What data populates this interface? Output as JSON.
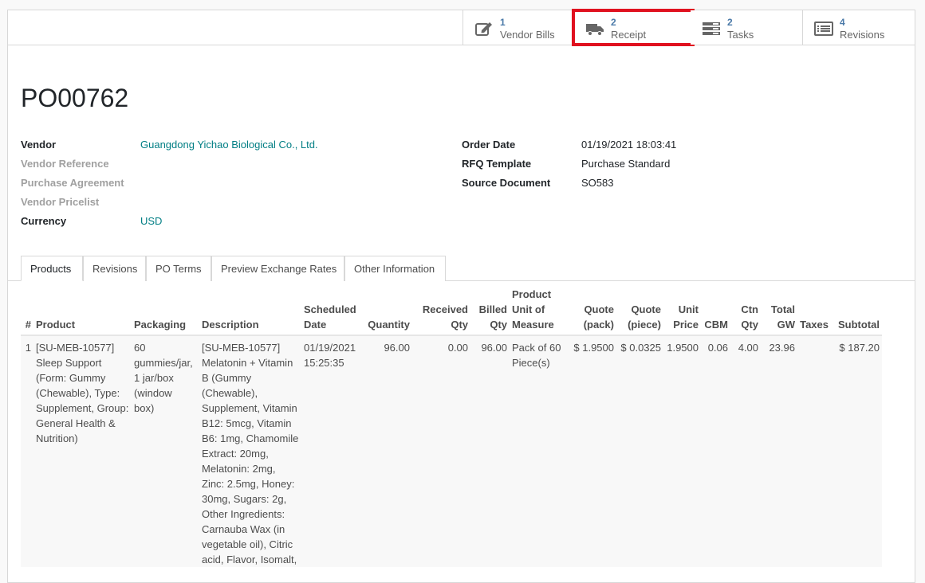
{
  "smart_buttons": [
    {
      "count": "1",
      "label": "Vendor Bills",
      "icon": "pencil-square-icon"
    },
    {
      "count": "2",
      "label": "Receipt",
      "icon": "truck-icon"
    },
    {
      "count": "2",
      "label": "Tasks",
      "icon": "tasks-icon"
    },
    {
      "count": "4",
      "label": "Revisions",
      "icon": "list-alt-icon"
    }
  ],
  "highlight_color": "#e0111f",
  "link_color": "#017e84",
  "po_name": "PO00762",
  "left_fields": [
    {
      "label": "Vendor",
      "value": "Guangdong Yichao Biological Co., Ltd."
    },
    {
      "label": "Vendor Reference",
      "value": ""
    },
    {
      "label": "Purchase Agreement",
      "value": ""
    },
    {
      "label": "Vendor Pricelist",
      "value": ""
    },
    {
      "label": "Currency",
      "value": "USD"
    }
  ],
  "right_fields": [
    {
      "label": "Order Date",
      "value": "01/19/2021 18:03:41"
    },
    {
      "label": "RFQ Template",
      "value": "Purchase Standard"
    },
    {
      "label": "Source Document",
      "value": "SO583"
    }
  ],
  "tabs": [
    "Products",
    "Revisions",
    "PO Terms",
    "Preview Exchange Rates",
    "Other Information"
  ],
  "columns": {
    "num": "#",
    "product": "Product",
    "packaging": "Packaging",
    "description": "Description",
    "scheduled_1": "Scheduled",
    "scheduled_2": "Date",
    "quantity": "Quantity",
    "received_1": "Received",
    "received_2": "Qty",
    "billed_1": "Billed",
    "billed_2": "Qty",
    "uom_1": "Product",
    "uom_2": "Unit of",
    "uom_3": "Measure",
    "quote_pack_1": "Quote",
    "quote_pack_2": "(pack)",
    "quote_piece_1": "Quote",
    "quote_piece_2": "(piece)",
    "unit_price_1": "Unit",
    "unit_price_2": "Price",
    "cbm": "CBM",
    "ctn_1": "Ctn",
    "ctn_2": "Qty",
    "gw_1": "Total",
    "gw_2": "GW",
    "taxes": "Taxes",
    "subtotal": "Subtotal"
  },
  "line": {
    "num": "1",
    "product_lines": [
      "[SU-MEB-10577]",
      "Sleep Support",
      "(Form: Gummy",
      "(Chewable), Type:",
      "Supplement, Group:",
      "General Health &",
      "Nutrition)"
    ],
    "packaging_lines": [
      "60",
      "gummies/jar,",
      "1 jar/box",
      "(window",
      "box)"
    ],
    "description_lines": [
      "[SU-MEB-10577]",
      "Melatonin + Vitamin",
      "B (Gummy",
      "(Chewable),",
      "Supplement, Vitamin",
      "B12: 5mcg, Vitamin",
      "B6: 1mg, Chamomile",
      "Extract: 20mg,",
      "Melatonin: 2mg,",
      "Zinc: 2.5mg, Honey:",
      "30mg, Sugars: 2g,",
      "Other Ingredients:",
      "Carnauba Wax (in",
      "vegetable oil), Citric",
      "acid, Flavor, Isomalt,"
    ],
    "date_lines": [
      "01/19/2021",
      "15:25:35"
    ],
    "quantity": "96.00",
    "received": "0.00",
    "billed": "96.00",
    "uom_lines": [
      "Pack of 60",
      "Piece(s)"
    ],
    "quote_pack": "$ 1.9500",
    "quote_piece": "$ 0.0325",
    "unit_price": "1.9500",
    "cbm": "0.06",
    "ctn_qty": "4.00",
    "total_gw": "23.96",
    "taxes": "",
    "subtotal": "$ 187.20"
  }
}
